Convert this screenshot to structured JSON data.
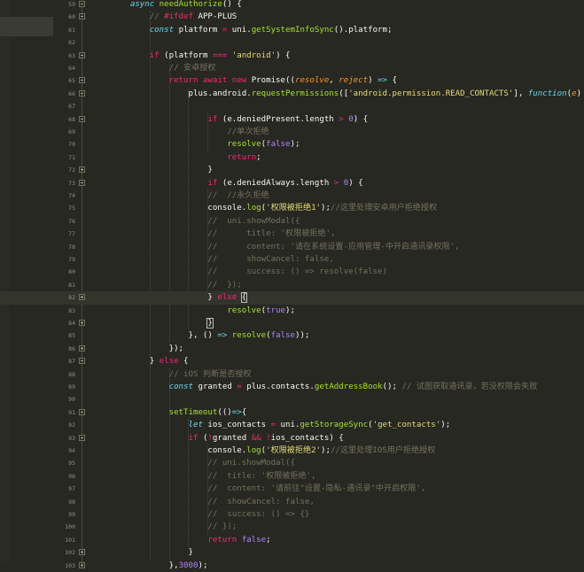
{
  "editor": {
    "lines": [
      {
        "no": "59",
        "segs": [
          {
            "t": "        "
          },
          {
            "t": "async ",
            "c": "st"
          },
          {
            "t": "needAuthorize",
            "c": "f"
          },
          {
            "t": "() {"
          }
        ]
      },
      {
        "no": "60",
        "segs": [
          {
            "t": "            "
          },
          {
            "t": "// ",
            "c": "c"
          },
          {
            "t": "#ifdef ",
            "c": "k"
          },
          {
            "t": "APP-PLUS"
          }
        ]
      },
      {
        "no": "61",
        "segs": [
          {
            "t": "            "
          },
          {
            "t": "const ",
            "c": "st"
          },
          {
            "t": "platform "
          },
          {
            "t": "= ",
            "c": "k"
          },
          {
            "t": "uni."
          },
          {
            "t": "getSystemInfoSync",
            "c": "f"
          },
          {
            "t": "().platform;"
          }
        ]
      },
      {
        "no": "62",
        "segs": [
          {
            "t": ""
          }
        ]
      },
      {
        "no": "63",
        "segs": [
          {
            "t": "            "
          },
          {
            "t": "if ",
            "c": "k"
          },
          {
            "t": "(platform "
          },
          {
            "t": "=== ",
            "c": "k"
          },
          {
            "t": "'android'",
            "c": "s"
          },
          {
            "t": ") {"
          }
        ]
      },
      {
        "no": "64",
        "segs": [
          {
            "t": "                "
          },
          {
            "t": "// 安卓授权",
            "c": "c"
          }
        ]
      },
      {
        "no": "65",
        "segs": [
          {
            "t": "                "
          },
          {
            "t": "return await new ",
            "c": "k"
          },
          {
            "t": "Promise(("
          },
          {
            "t": "resolve",
            "c": "p"
          },
          {
            "t": ", "
          },
          {
            "t": "reject",
            "c": "p"
          },
          {
            "t": ") "
          },
          {
            "t": "=> ",
            "c": "st"
          },
          {
            "t": "{"
          }
        ]
      },
      {
        "no": "66",
        "segs": [
          {
            "t": "                    "
          },
          {
            "t": "plus.android."
          },
          {
            "t": "requestPermissions",
            "c": "f"
          },
          {
            "t": "(["
          },
          {
            "t": "'android.permission.READ_CONTACTS'",
            "c": "s"
          },
          {
            "t": "], "
          },
          {
            "t": "function",
            "c": "st"
          },
          {
            "t": "("
          },
          {
            "t": "e",
            "c": "p"
          },
          {
            "t": ") {"
          }
        ]
      },
      {
        "no": "67",
        "segs": [
          {
            "t": ""
          }
        ]
      },
      {
        "no": "68",
        "segs": [
          {
            "t": "                        "
          },
          {
            "t": "if ",
            "c": "k"
          },
          {
            "t": "(e.deniedPresent.length "
          },
          {
            "t": "> ",
            "c": "k"
          },
          {
            "t": "0",
            "c": "n"
          },
          {
            "t": ") {"
          }
        ]
      },
      {
        "no": "69",
        "segs": [
          {
            "t": "                            "
          },
          {
            "t": "//单次拒绝",
            "c": "c"
          }
        ]
      },
      {
        "no": "70",
        "segs": [
          {
            "t": "                            "
          },
          {
            "t": "resolve",
            "c": "f"
          },
          {
            "t": "("
          },
          {
            "t": "false",
            "c": "n"
          },
          {
            "t": ");"
          }
        ]
      },
      {
        "no": "71",
        "segs": [
          {
            "t": "                            "
          },
          {
            "t": "return",
            "c": "k"
          },
          {
            "t": ";"
          }
        ]
      },
      {
        "no": "72",
        "segs": [
          {
            "t": "                        }"
          }
        ]
      },
      {
        "no": "73",
        "segs": [
          {
            "t": "                        "
          },
          {
            "t": "if ",
            "c": "k"
          },
          {
            "t": "(e.deniedAlways.length "
          },
          {
            "t": "> ",
            "c": "k"
          },
          {
            "t": "0",
            "c": "n"
          },
          {
            "t": ") {"
          }
        ]
      },
      {
        "no": "74",
        "segs": [
          {
            "t": "                        "
          },
          {
            "t": "//  //永久拒绝",
            "c": "c"
          }
        ]
      },
      {
        "no": "75",
        "segs": [
          {
            "t": "                        "
          },
          {
            "t": "console."
          },
          {
            "t": "log",
            "c": "f"
          },
          {
            "t": "("
          },
          {
            "t": "'权限被拒绝1'",
            "c": "s"
          },
          {
            "t": ");"
          },
          {
            "t": "//这里处理安卓用户拒绝授权",
            "c": "c"
          }
        ]
      },
      {
        "no": "76",
        "segs": [
          {
            "t": "                        "
          },
          {
            "t": "//  uni.showModal({",
            "c": "c"
          }
        ]
      },
      {
        "no": "77",
        "segs": [
          {
            "t": "                        "
          },
          {
            "t": "//      title: '权限被拒绝',",
            "c": "c"
          }
        ]
      },
      {
        "no": "78",
        "segs": [
          {
            "t": "                        "
          },
          {
            "t": "//      content: '请在系统设置-应用管理-中开启通讯录权限',",
            "c": "c"
          }
        ]
      },
      {
        "no": "79",
        "segs": [
          {
            "t": "                        "
          },
          {
            "t": "//      showCancel: false,",
            "c": "c"
          }
        ]
      },
      {
        "no": "80",
        "segs": [
          {
            "t": "                        "
          },
          {
            "t": "//      success: () => resolve(false)",
            "c": "c"
          }
        ]
      },
      {
        "no": "81",
        "segs": [
          {
            "t": "                        "
          },
          {
            "t": "//  });",
            "c": "c"
          }
        ]
      },
      {
        "no": "82",
        "segs": [
          {
            "t": "                        "
          },
          {
            "t": "} "
          },
          {
            "t": "else ",
            "c": "k"
          },
          {
            "t": "{",
            "bm": true
          }
        ]
      },
      {
        "no": "83",
        "segs": [
          {
            "t": "                            "
          },
          {
            "t": "resolve",
            "c": "f"
          },
          {
            "t": "("
          },
          {
            "t": "true",
            "c": "n"
          },
          {
            "t": ");"
          }
        ]
      },
      {
        "no": "84",
        "segs": [
          {
            "t": "                        "
          },
          {
            "t": "}",
            "bm": true
          }
        ]
      },
      {
        "no": "85",
        "segs": [
          {
            "t": "                    }, () "
          },
          {
            "t": "=> ",
            "c": "st"
          },
          {
            "t": "resolve",
            "c": "f"
          },
          {
            "t": "("
          },
          {
            "t": "false",
            "c": "n"
          },
          {
            "t": "));"
          }
        ]
      },
      {
        "no": "86",
        "segs": [
          {
            "t": "                });"
          }
        ]
      },
      {
        "no": "87",
        "segs": [
          {
            "t": "            } "
          },
          {
            "t": "else ",
            "c": "k"
          },
          {
            "t": "{"
          }
        ]
      },
      {
        "no": "88",
        "segs": [
          {
            "t": "                "
          },
          {
            "t": "// iOS 判断是否授权",
            "c": "c"
          }
        ]
      },
      {
        "no": "89",
        "segs": [
          {
            "t": "                "
          },
          {
            "t": "const ",
            "c": "st"
          },
          {
            "t": "granted "
          },
          {
            "t": "= ",
            "c": "k"
          },
          {
            "t": "plus.contacts."
          },
          {
            "t": "getAddressBook",
            "c": "f"
          },
          {
            "t": "(); "
          },
          {
            "t": "// 试图获取通讯录，若没权限会失败",
            "c": "c"
          }
        ]
      },
      {
        "no": "90",
        "segs": [
          {
            "t": ""
          }
        ]
      },
      {
        "no": "91",
        "segs": [
          {
            "t": "                "
          },
          {
            "t": "setTimeout",
            "c": "f"
          },
          {
            "t": "(()"
          },
          {
            "t": "=>",
            "c": "st"
          },
          {
            "t": "{"
          }
        ]
      },
      {
        "no": "92",
        "segs": [
          {
            "t": "                    "
          },
          {
            "t": "let ",
            "c": "st"
          },
          {
            "t": "ios_contacts "
          },
          {
            "t": "= ",
            "c": "k"
          },
          {
            "t": "uni."
          },
          {
            "t": "getStorageSync",
            "c": "f"
          },
          {
            "t": "("
          },
          {
            "t": "'get_contacts'",
            "c": "s"
          },
          {
            "t": ");"
          }
        ]
      },
      {
        "no": "93",
        "segs": [
          {
            "t": "                    "
          },
          {
            "t": "if ",
            "c": "k"
          },
          {
            "t": "("
          },
          {
            "t": "!",
            "c": "k"
          },
          {
            "t": "granted "
          },
          {
            "t": "&& !",
            "c": "k"
          },
          {
            "t": "ios_contacts) {"
          }
        ]
      },
      {
        "no": "94",
        "segs": [
          {
            "t": "                        "
          },
          {
            "t": "console."
          },
          {
            "t": "log",
            "c": "f"
          },
          {
            "t": "("
          },
          {
            "t": "'权限被拒绝2'",
            "c": "s"
          },
          {
            "t": ");"
          },
          {
            "t": "//这里处理IOS用户拒绝授权",
            "c": "c"
          }
        ]
      },
      {
        "no": "95",
        "segs": [
          {
            "t": "                        "
          },
          {
            "t": "// uni.showModal({",
            "c": "c"
          }
        ]
      },
      {
        "no": "96",
        "segs": [
          {
            "t": "                        "
          },
          {
            "t": "//  title: '权限被拒绝',",
            "c": "c"
          }
        ]
      },
      {
        "no": "97",
        "segs": [
          {
            "t": "                        "
          },
          {
            "t": "//  content: '请前往\"设置-隐私-通讯录\"中开启权限',",
            "c": "c"
          }
        ]
      },
      {
        "no": "98",
        "segs": [
          {
            "t": "                        "
          },
          {
            "t": "//  showCancel: false,",
            "c": "c"
          }
        ]
      },
      {
        "no": "99",
        "segs": [
          {
            "t": "                        "
          },
          {
            "t": "//  success: () => {}",
            "c": "c"
          }
        ]
      },
      {
        "no": "100",
        "segs": [
          {
            "t": "                        "
          },
          {
            "t": "// });",
            "c": "c"
          }
        ]
      },
      {
        "no": "101",
        "segs": [
          {
            "t": "                        "
          },
          {
            "t": "return ",
            "c": "k"
          },
          {
            "t": "false",
            "c": "n"
          },
          {
            "t": ";"
          }
        ]
      },
      {
        "no": "102",
        "segs": [
          {
            "t": "                    }"
          }
        ]
      },
      {
        "no": "103",
        "segs": [
          {
            "t": "                },"
          },
          {
            "t": "3000",
            "c": "n"
          },
          {
            "t": ");"
          }
        ]
      }
    ],
    "fold_markers": {
      "59": "minus",
      "60": "minus",
      "63": "minus",
      "65": "minus",
      "66": "minus",
      "68": "minus",
      "72": "plus",
      "73": "minus",
      "82": "plus",
      "84": "plus",
      "86": "plus",
      "87": "minus",
      "91": "minus",
      "93": "minus",
      "102": "plus",
      "103": "plus"
    },
    "current_line": "82"
  }
}
